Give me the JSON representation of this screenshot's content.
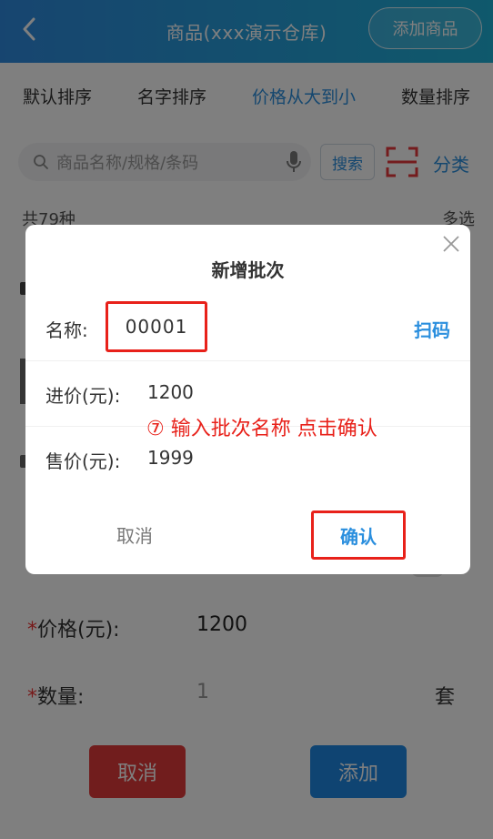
{
  "header": {
    "title": "商品(xxx演示仓库)",
    "add_label": "添加商品"
  },
  "sort": {
    "tabs": [
      "默认排序",
      "名字排序",
      "价格从大到小",
      "数量排序"
    ],
    "active_index": 2
  },
  "search": {
    "placeholder": "商品名称/规格/条码",
    "button_label": "搜索",
    "category_label": "分类"
  },
  "list": {
    "count_label": "共79种",
    "multi_label": "多选"
  },
  "sheet": {
    "price_label": "价格(元):",
    "price_value": "1200",
    "qty_label": "数量:",
    "qty_value": "1",
    "unit": "套",
    "required_mark": "*",
    "cancel_label": "取消",
    "add_label": "添加"
  },
  "dialog": {
    "title": "新增批次",
    "name_label": "名称:",
    "name_value": "00001",
    "scan_label": "扫码",
    "cost_label": "进价(元):",
    "cost_value": "1200",
    "sale_label": "售价(元):",
    "sale_value": "1999",
    "instruction": "⑦ 输入批次名称 点击确认",
    "cancel_label": "取消",
    "confirm_label": "确认"
  },
  "colors": {
    "accent": "#2b8fde",
    "highlight": "#e8211a",
    "danger": "#e33b3b",
    "primary": "#1e88e5"
  }
}
